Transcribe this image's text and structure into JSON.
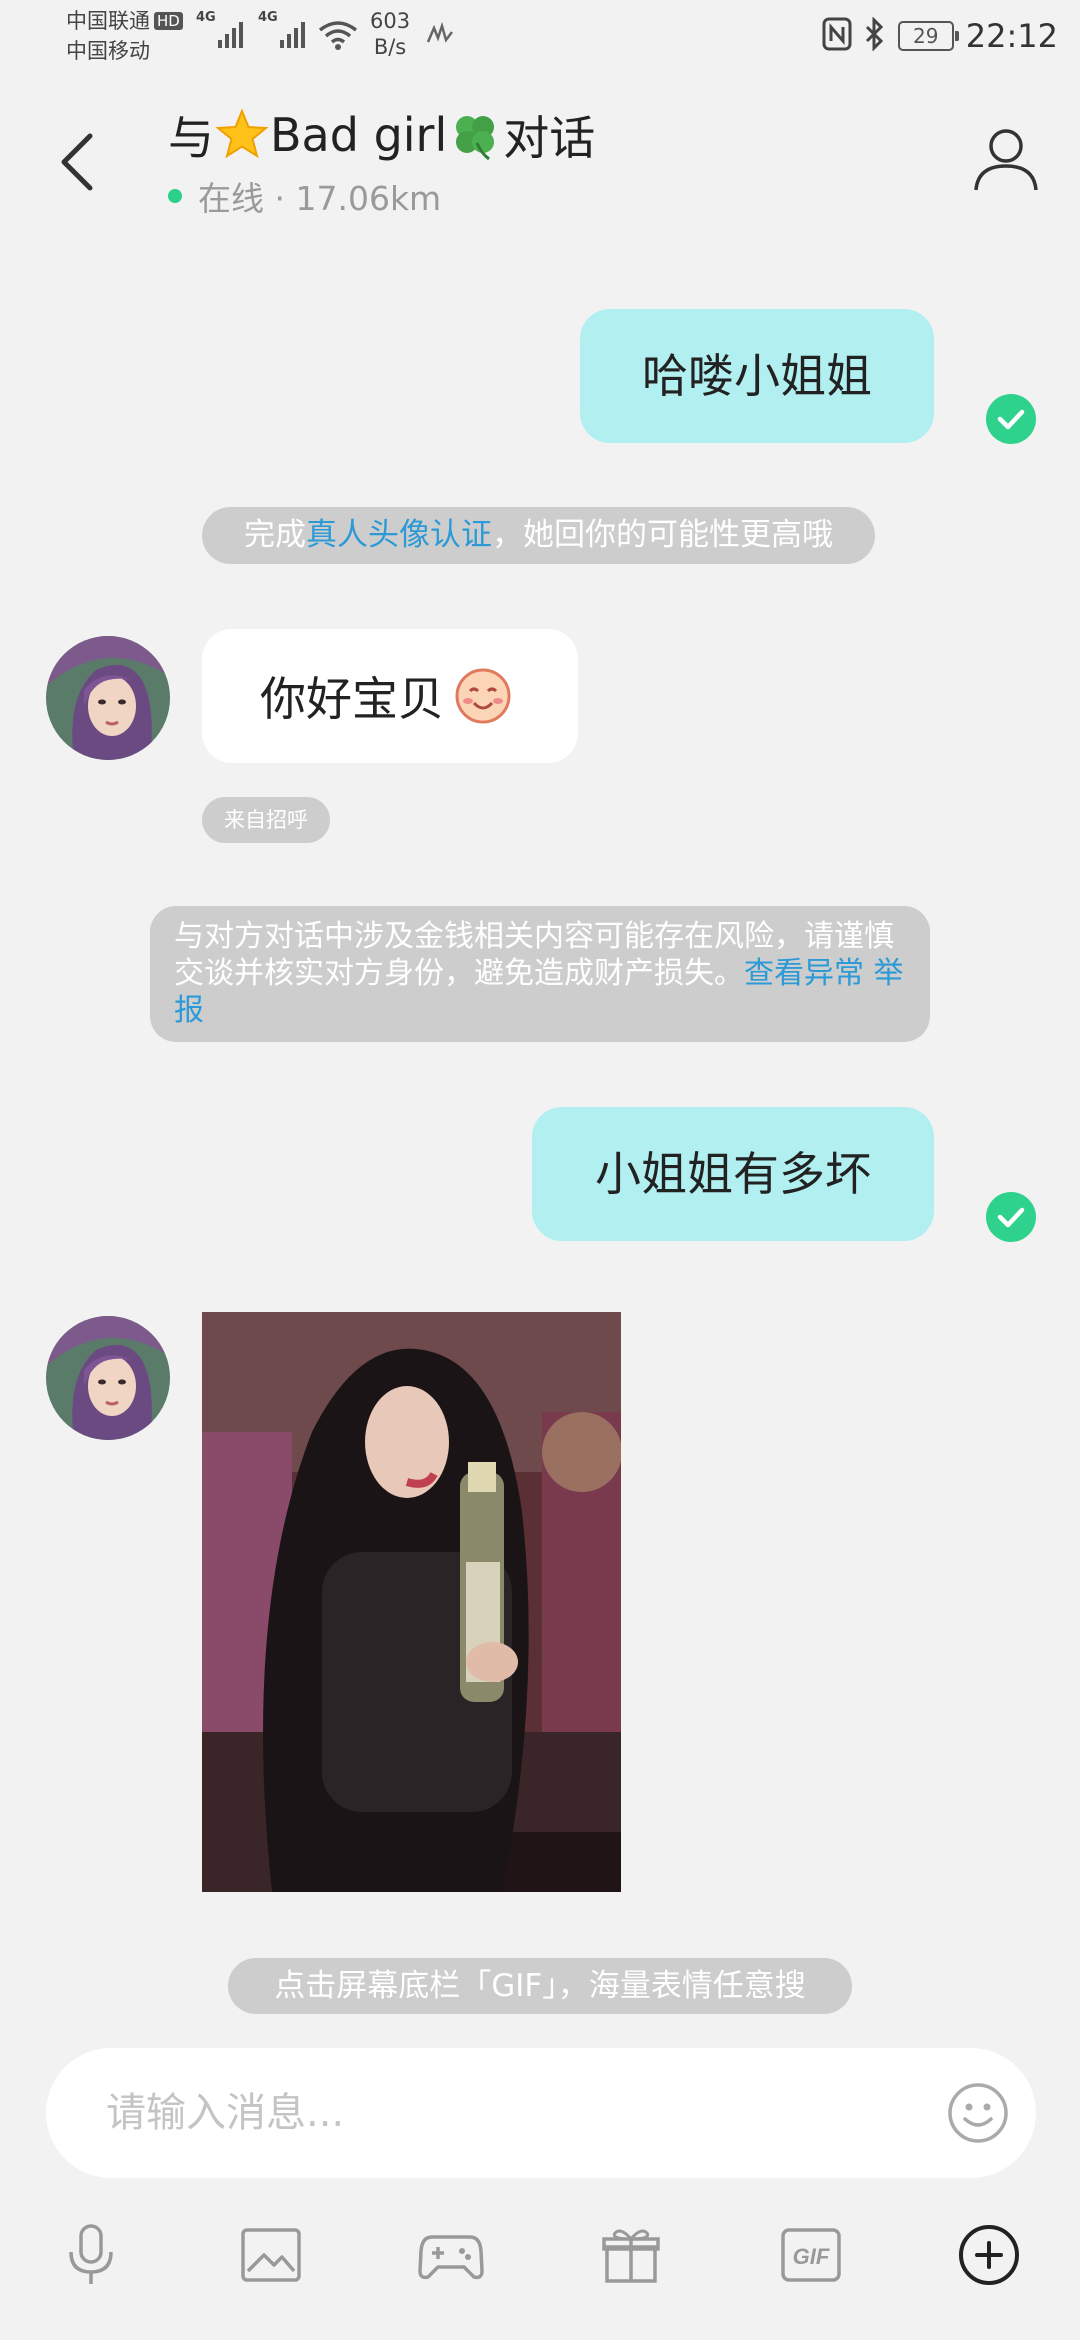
{
  "status_bar": {
    "carrier_1": "中国联通",
    "carrier_1_badge": "HD",
    "carrier_2": "中国移动",
    "signal_1_label": "4G",
    "signal_2_label": "4G",
    "net_speed_value": "603",
    "net_speed_unit": "B/s",
    "battery": "29",
    "time": "22:12"
  },
  "header": {
    "title_prefix": "与",
    "title_name": "Bad girl",
    "title_suffix": "对话",
    "status": "在线 · 17.06km"
  },
  "messages": {
    "m1": "哈喽小姐姐",
    "m2": "你好宝贝",
    "m3": "小姐姐有多坏"
  },
  "system": {
    "verify_prefix": "完成",
    "verify_link": "真人头像认证",
    "verify_suffix": "，她回你的可能性更高哦",
    "greeting_tag": "来自招呼",
    "risk_text": "与对方对话中涉及金钱相关内容可能存在风险，请谨慎交谈并核实对方身份，避免造成财产损失。",
    "risk_link_1": "查看异常",
    "risk_link_2": "举报",
    "gif_tip": "点击屏幕底栏「GIF」，海量表情任意搜"
  },
  "input": {
    "placeholder": "请输入消息..."
  },
  "toolbar": {
    "gif_label": "GIF"
  },
  "colors": {
    "outgoing_bubble": "#b1eff0",
    "sent_check": "#2fd28c",
    "online_dot": "#2bd08a",
    "link": "#2b9ad6",
    "system_pill": "#cdcdcd"
  }
}
